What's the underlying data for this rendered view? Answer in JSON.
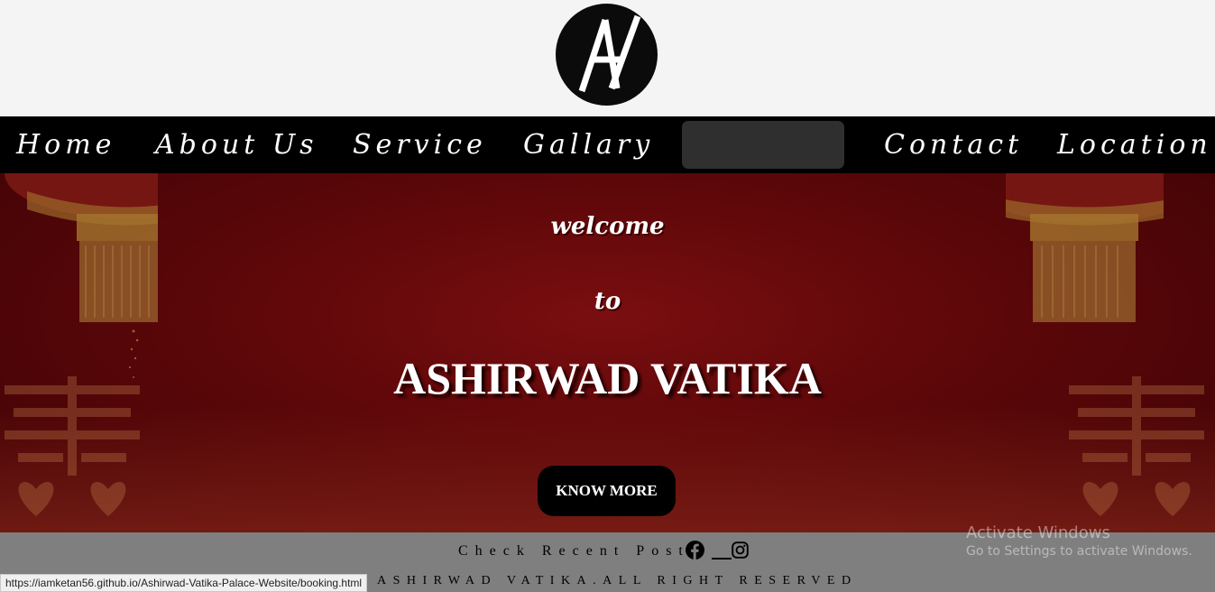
{
  "logo": {
    "text": "AV"
  },
  "nav": {
    "items": [
      {
        "label": "Home"
      },
      {
        "label": "About Us"
      },
      {
        "label": "Service"
      },
      {
        "label": "Gallary"
      },
      {
        "label": "Contact"
      },
      {
        "label": "Location"
      }
    ]
  },
  "hero": {
    "welcome": "welcome",
    "to": "to",
    "title": "ASHIRWAD VATIKA",
    "button_label": "KNOW MORE"
  },
  "footer": {
    "check_recent": "Check Recent Post",
    "social_icons": [
      "facebook-icon",
      "instagram-icon"
    ],
    "rights": "ASHIRWAD VATIKA.ALL RIGHT RESERVED",
    "background": "#7f7f7f"
  },
  "overlay": {
    "activate_title": "Activate Windows",
    "activate_sub": "Go to Settings to activate Windows."
  },
  "status_bar": {
    "url": "https://iamketan56.github.io/Ashirwad-Vatika-Palace-Website/booking.html"
  },
  "colors": {
    "nav_background": "#000000",
    "hero_red": "#5c0709",
    "button_background": "#000000"
  }
}
